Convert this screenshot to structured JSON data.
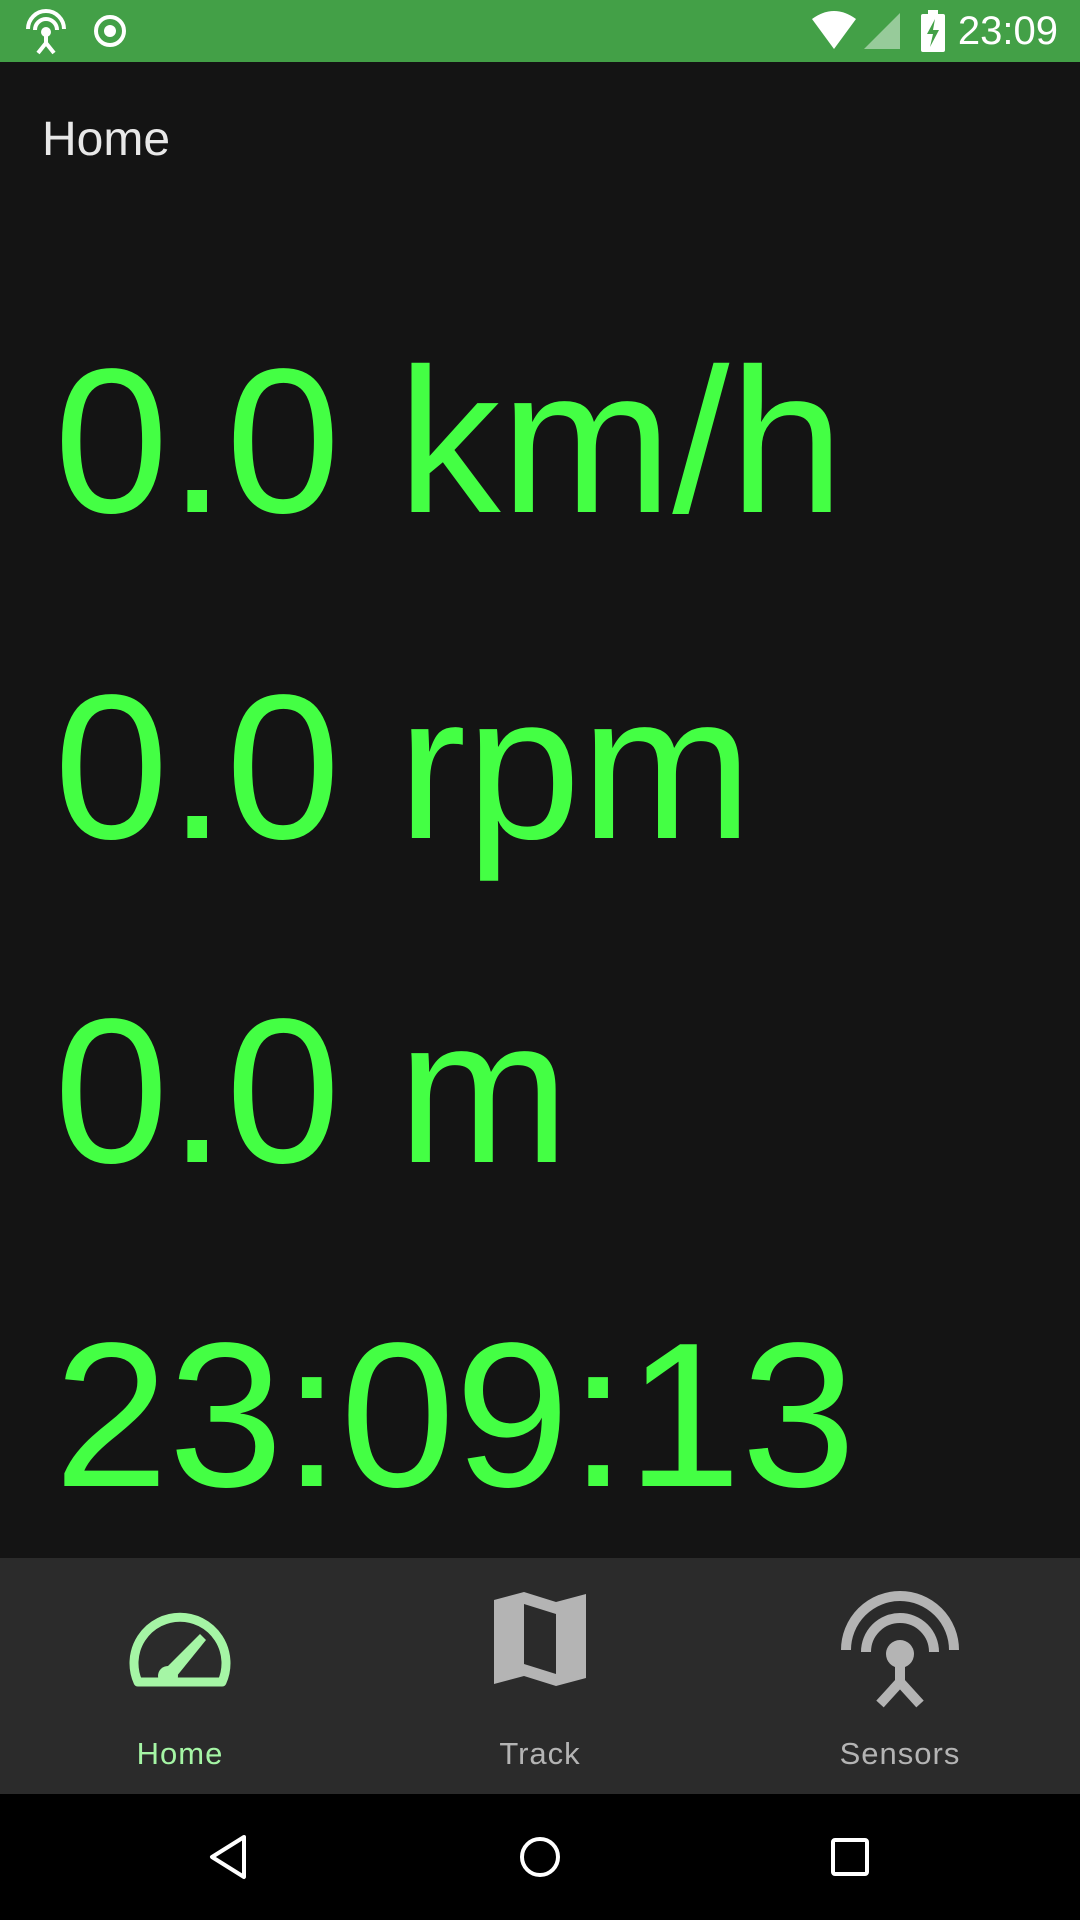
{
  "status_bar": {
    "time": "23:09",
    "icons": [
      "hotspot-icon",
      "location-target-icon",
      "wifi-icon",
      "signal-icon",
      "battery-charging-icon"
    ]
  },
  "app_bar": {
    "title": "Home"
  },
  "readouts": {
    "speed": "0.0 km/h",
    "rpm": "0.0 rpm",
    "altitude": "0.0 m",
    "clock": "23:09:13"
  },
  "bottom_nav": {
    "items": [
      {
        "label": "Home",
        "icon": "speedometer-icon",
        "selected": true
      },
      {
        "label": "Track",
        "icon": "map-icon",
        "selected": false
      },
      {
        "label": "Sensors",
        "icon": "sensors-antenna-icon",
        "selected": false
      }
    ]
  },
  "system_nav": {
    "buttons": [
      "back-icon",
      "home-circle-icon",
      "recents-square-icon"
    ]
  },
  "colors": {
    "status_bar": "#43a047",
    "background": "#141414",
    "readout": "#44ff44",
    "nav_background": "#2b2b2b",
    "nav_selected": "#a5f5a5",
    "nav_unselected": "#b4b4b4"
  }
}
